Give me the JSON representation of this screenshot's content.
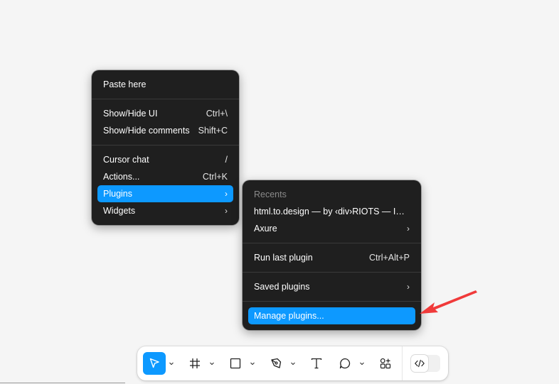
{
  "context_menu": {
    "paste_here": "Paste here",
    "show_hide_ui": {
      "label": "Show/Hide UI",
      "shortcut": "Ctrl+\\"
    },
    "show_hide_comments": {
      "label": "Show/Hide comments",
      "shortcut": "Shift+C"
    },
    "cursor_chat": {
      "label": "Cursor chat",
      "shortcut": "/"
    },
    "actions": {
      "label": "Actions...",
      "shortcut": "Ctrl+K"
    },
    "plugins": {
      "label": "Plugins",
      "chevron": "›"
    },
    "widgets": {
      "label": "Widgets",
      "chevron": "›"
    }
  },
  "plugins_menu": {
    "recents_header": "Recents",
    "html_to_design": "html.to.design — by ‹div›RIOTS — Im...",
    "axure": {
      "label": "Axure",
      "chevron": "›"
    },
    "run_last_plugin": {
      "label": "Run last plugin",
      "shortcut": "Ctrl+Alt+P"
    },
    "saved_plugins": {
      "label": "Saved plugins",
      "chevron": "›"
    },
    "manage_plugins": "Manage plugins..."
  },
  "toolbar": {
    "tools": [
      {
        "icon": "move-cursor-icon",
        "active": true,
        "has_dropdown": true
      },
      {
        "icon": "frame-icon",
        "active": false,
        "has_dropdown": true
      },
      {
        "icon": "rectangle-icon",
        "active": false,
        "has_dropdown": true
      },
      {
        "icon": "pen-icon",
        "active": false,
        "has_dropdown": true
      },
      {
        "icon": "text-icon",
        "active": false,
        "has_dropdown": false
      },
      {
        "icon": "comment-icon",
        "active": false,
        "has_dropdown": true
      },
      {
        "icon": "resources-icon",
        "active": false,
        "has_dropdown": false
      }
    ],
    "dev_mode_icon": "code-icon"
  },
  "colors": {
    "menu_bg": "#1f1f1f",
    "accent": "#0d99ff",
    "annotation_arrow": "#f03a3a",
    "canvas_bg": "#f5f5f5"
  }
}
